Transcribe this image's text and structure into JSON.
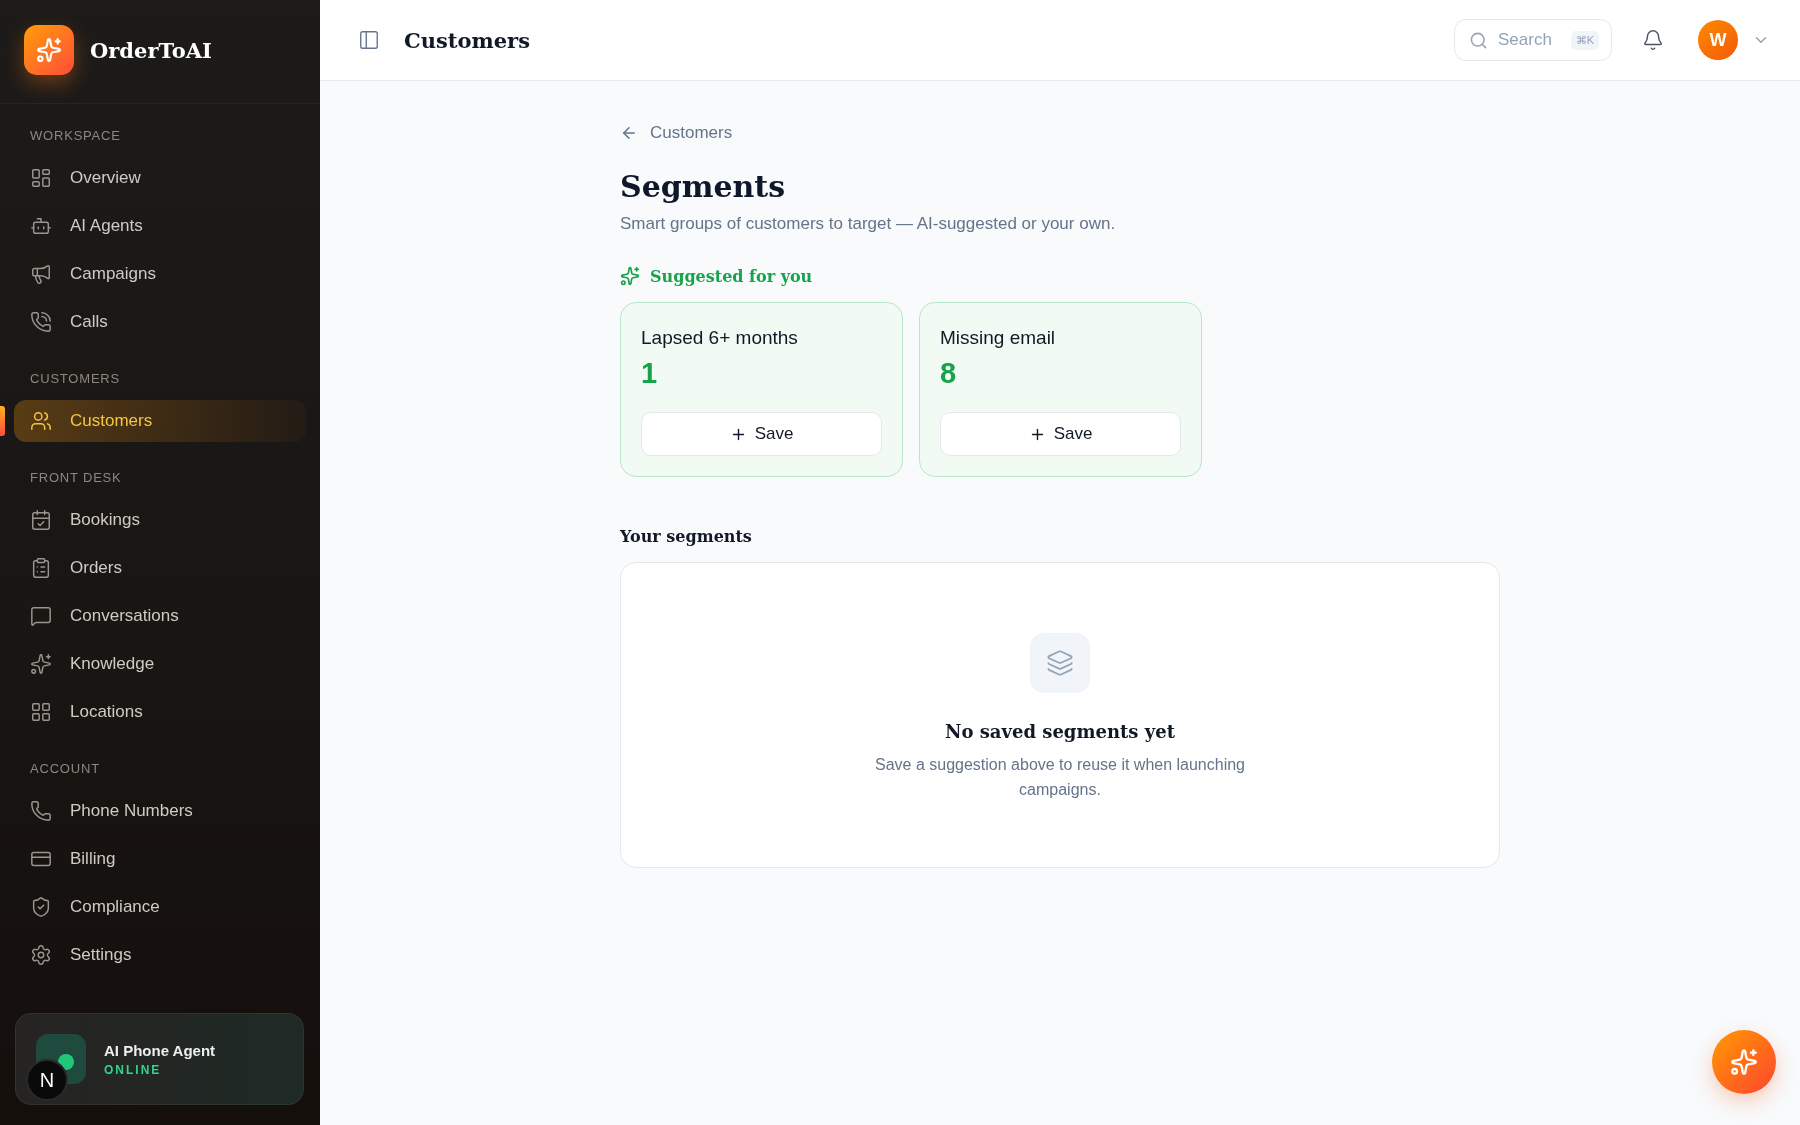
{
  "brand": {
    "name": "OrderToAI"
  },
  "sidebar": {
    "sections": [
      {
        "heading": "WORKSPACE",
        "items": [
          {
            "label": "Overview",
            "selected": false
          },
          {
            "label": "AI Agents",
            "selected": false
          },
          {
            "label": "Campaigns",
            "selected": false
          },
          {
            "label": "Calls",
            "selected": false
          }
        ]
      },
      {
        "heading": "CUSTOMERS",
        "items": [
          {
            "label": "Customers",
            "selected": true
          }
        ]
      },
      {
        "heading": "FRONT DESK",
        "items": [
          {
            "label": "Bookings",
            "selected": false
          },
          {
            "label": "Orders",
            "selected": false
          },
          {
            "label": "Conversations",
            "selected": false
          },
          {
            "label": "Knowledge",
            "selected": false
          },
          {
            "label": "Locations",
            "selected": false
          }
        ]
      },
      {
        "heading": "ACCOUNT",
        "items": [
          {
            "label": "Phone Numbers",
            "selected": false
          },
          {
            "label": "Billing",
            "selected": false
          },
          {
            "label": "Compliance",
            "selected": false
          },
          {
            "label": "Settings",
            "selected": false
          }
        ]
      }
    ]
  },
  "agent_card": {
    "title": "AI Phone Agent",
    "status": "ONLINE",
    "dev_badge": "N"
  },
  "header": {
    "title": "Customers",
    "search": {
      "placeholder": "Search",
      "shortcut": "⌘K"
    },
    "avatar": "W"
  },
  "breadcrumb": "Customers",
  "page": {
    "title": "Segments",
    "subtitle": "Smart groups of customers to target — AI-suggested or your own."
  },
  "suggested": {
    "heading": "Suggested for you",
    "cards": [
      {
        "title": "Lapsed 6+ months",
        "count": "1",
        "button": "Save"
      },
      {
        "title": "Missing email",
        "count": "8",
        "button": "Save"
      }
    ]
  },
  "your_segments": {
    "heading": "Your segments",
    "empty_title": "No saved segments yet",
    "empty_text": "Save a suggestion above to reuse it when launching campaigns."
  }
}
